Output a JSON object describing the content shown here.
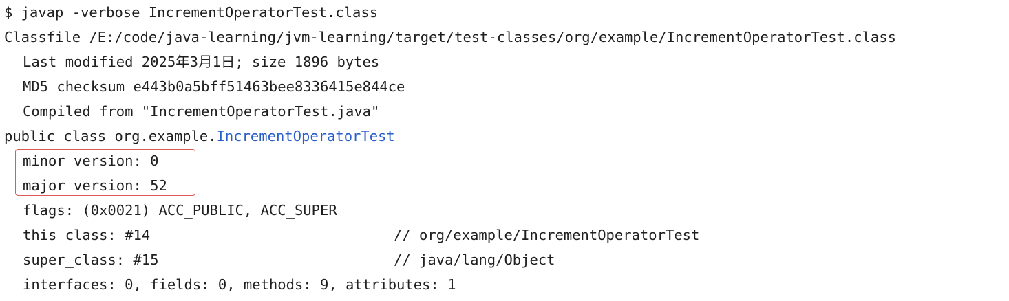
{
  "terminal": {
    "command": "$ javap -verbose IncrementOperatorTest.class",
    "classfile": "Classfile /E:/code/java-learning/jvm-learning/target/test-classes/org/example/IncrementOperatorTest.class",
    "last_modified": "Last modified 2025年3月1日; size 1896 bytes",
    "md5": "MD5 checksum e443b0a5bff51463bee8336415e844ce",
    "compiled_from": "Compiled from \"IncrementOperatorTest.java\"",
    "class_decl_prefix": "public class org.example.",
    "class_name_link": "IncrementOperatorTest",
    "minor_version": "minor version: 0",
    "major_version": "major version: 52",
    "flags": "flags: (0x0021) ACC_PUBLIC, ACC_SUPER",
    "this_class": "this_class: #14",
    "this_class_comment": "// org/example/IncrementOperatorTest",
    "super_class": "super_class: #15",
    "super_class_comment": "// java/lang/Object",
    "interfaces": "interfaces: 0, fields: 0, methods: 9, attributes: 1"
  },
  "colors": {
    "text": "#1f1f1f",
    "link": "#2a5fc9",
    "highlight_border": "#e05a5a",
    "background": "#ffffff"
  }
}
